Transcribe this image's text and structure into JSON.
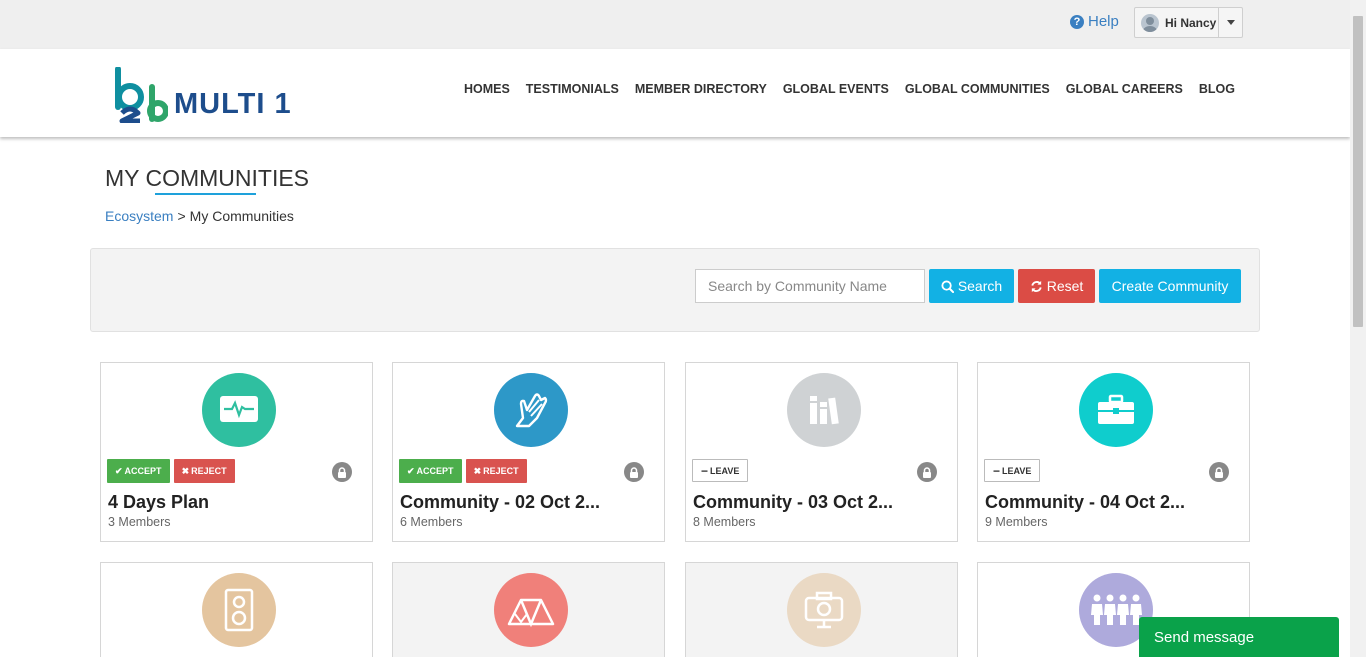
{
  "topbar": {
    "help_label": "Help",
    "user_label": "Hi Nancy"
  },
  "header": {
    "logo_text": "MULTI 1",
    "nav": [
      "HOMES",
      "TESTIMONIALS",
      "MEMBER DIRECTORY",
      "GLOBAL EVENTS",
      "GLOBAL COMMUNITIES",
      "GLOBAL CAREERS",
      "BLOG"
    ]
  },
  "page": {
    "title": "MY COMMUNITIES",
    "breadcrumb": {
      "root": "Ecosystem",
      "separator": ">",
      "current": "My Communities"
    }
  },
  "search": {
    "placeholder": "Search by Community Name",
    "search_label": "Search",
    "reset_label": "Reset",
    "create_label": "Create Community"
  },
  "labels": {
    "accept": "ACCEPT",
    "reject": "REJECT",
    "leave": "LEAVE"
  },
  "communities": [
    {
      "title": "4 Days Plan",
      "members": "3 Members",
      "icon": "pulse-monitor-icon",
      "color": "#2fbfa0",
      "state": "invite"
    },
    {
      "title": "Community - 02 Oct 2...",
      "members": "6 Members",
      "icon": "praying-hands-icon",
      "color": "#2d98c8",
      "state": "invite"
    },
    {
      "title": "Community - 03 Oct 2...",
      "members": "8 Members",
      "icon": "books-icon",
      "color": "#cfd2d4",
      "state": "member"
    },
    {
      "title": "Community - 04 Oct 2...",
      "members": "9 Members",
      "icon": "briefcase-icon",
      "color": "#0fcdcd",
      "state": "member"
    },
    {
      "icon": "speaker-icon",
      "color": "#e4c59f"
    },
    {
      "icon": "tent-icon",
      "color": "#f0807a"
    },
    {
      "icon": "camera-icon",
      "color": "#ead9c4"
    },
    {
      "icon": "people-group-icon",
      "color": "#aeaadc"
    }
  ],
  "chat": {
    "label": "Send message"
  }
}
